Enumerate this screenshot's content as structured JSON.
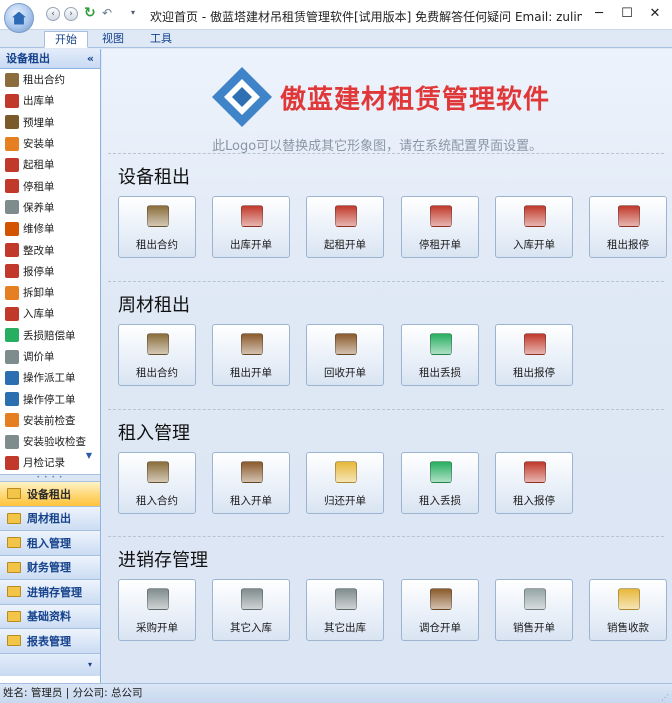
{
  "titlebar": {
    "title": "欢迎首页 - 傲蓝塔建材吊租赁管理软件[试用版本] 免费解答任何疑问 Email: zulin...",
    "minimize": "─",
    "maximize": "☐",
    "close": "✕"
  },
  "tabs": [
    "开始",
    "视图",
    "工具"
  ],
  "sidebar": {
    "header": "设备租出",
    "collapse": "«",
    "items": [
      {
        "label": "租出合约",
        "icon": "contract-icon",
        "color": "#8a6d3b"
      },
      {
        "label": "出库单",
        "icon": "truck-out-icon",
        "color": "#c0392b"
      },
      {
        "label": "预埋单",
        "icon": "shovel-icon",
        "color": "#7a5a2a"
      },
      {
        "label": "安装单",
        "icon": "install-icon",
        "color": "#e67e22"
      },
      {
        "label": "起租单",
        "icon": "calendar-start-icon",
        "color": "#c0392b"
      },
      {
        "label": "停租单",
        "icon": "calendar-stop-icon",
        "color": "#c0392b"
      },
      {
        "label": "保养单",
        "icon": "maintenance-icon",
        "color": "#7f8c8d"
      },
      {
        "label": "维修单",
        "icon": "repair-icon",
        "color": "#d35400"
      },
      {
        "label": "整改单",
        "icon": "rectify-icon",
        "color": "#c0392b"
      },
      {
        "label": "报停单",
        "icon": "report-stop-icon",
        "color": "#c0392b"
      },
      {
        "label": "拆卸单",
        "icon": "dismantle-icon",
        "color": "#e67e22"
      },
      {
        "label": "入库单",
        "icon": "truck-in-icon",
        "color": "#c0392b"
      },
      {
        "label": "丢损赔偿单",
        "icon": "loss-icon",
        "color": "#27ae60"
      },
      {
        "label": "调价单",
        "icon": "price-icon",
        "color": "#7f8c8d"
      },
      {
        "label": "操作派工单",
        "icon": "dispatch-icon",
        "color": "#2c6fb0"
      },
      {
        "label": "操作停工单",
        "icon": "stop-work-icon",
        "color": "#2c6fb0"
      },
      {
        "label": "安装前检查",
        "icon": "pre-check-icon",
        "color": "#e67e22"
      },
      {
        "label": "安装验收检查",
        "icon": "acceptance-icon",
        "color": "#7f8c8d"
      },
      {
        "label": "月检记录",
        "icon": "monthly-check-icon",
        "color": "#c0392b"
      }
    ],
    "groups": [
      {
        "label": "设备租出",
        "active": true
      },
      {
        "label": "周材租出",
        "active": false
      },
      {
        "label": "租入管理",
        "active": false
      },
      {
        "label": "财务管理",
        "active": false
      },
      {
        "label": "进销存管理",
        "active": false
      },
      {
        "label": "基础资料",
        "active": false
      },
      {
        "label": "报表管理",
        "active": false
      }
    ]
  },
  "logo": {
    "title": "傲蓝建材租赁管理软件",
    "subtitle": "此Logo可以替换成其它形象图，请在系统配置界面设置。",
    "color": "#e03838"
  },
  "sections": [
    {
      "title": "设备租出",
      "tiles": [
        {
          "label": "租出合约",
          "icon": "contract-icon",
          "color": "#8a6d3b"
        },
        {
          "label": "出库开单",
          "icon": "truck-out-icon",
          "color": "#c0392b"
        },
        {
          "label": "起租开单",
          "icon": "calendar-start-icon",
          "color": "#c0392b"
        },
        {
          "label": "停租开单",
          "icon": "calendar-stop-icon",
          "color": "#c0392b"
        },
        {
          "label": "入库开单",
          "icon": "truck-in-icon",
          "color": "#c0392b"
        },
        {
          "label": "租出报停",
          "icon": "report-stop-icon",
          "color": "#c0392b"
        }
      ]
    },
    {
      "title": "周材租出",
      "tiles": [
        {
          "label": "租出合约",
          "icon": "contract-icon",
          "color": "#8a6d3b"
        },
        {
          "label": "租出开单",
          "icon": "house-out-icon",
          "color": "#8a5a2b"
        },
        {
          "label": "回收开单",
          "icon": "house-return-icon",
          "color": "#8a5a2b"
        },
        {
          "label": "租出丢损",
          "icon": "loss-icon",
          "color": "#27ae60"
        },
        {
          "label": "租出报停",
          "icon": "report-stop-icon",
          "color": "#c0392b"
        }
      ]
    },
    {
      "title": "租入管理",
      "tiles": [
        {
          "label": "租入合约",
          "icon": "contract-icon",
          "color": "#8a6d3b"
        },
        {
          "label": "租入开单",
          "icon": "house-in-icon",
          "color": "#8a5a2b"
        },
        {
          "label": "归还开单",
          "icon": "return-icon",
          "color": "#e6b83a"
        },
        {
          "label": "租入丢损",
          "icon": "loss-icon",
          "color": "#27ae60"
        },
        {
          "label": "租入报停",
          "icon": "report-stop-icon",
          "color": "#c0392b"
        }
      ]
    },
    {
      "title": "进销存管理",
      "tiles": [
        {
          "label": "采购开单",
          "icon": "cart-icon",
          "color": "#7f8c8d"
        },
        {
          "label": "其它入库",
          "icon": "box-in-icon",
          "color": "#7f8c8d"
        },
        {
          "label": "其它出库",
          "icon": "box-out-icon",
          "color": "#7f8c8d"
        },
        {
          "label": "调仓开单",
          "icon": "warehouse-icon",
          "color": "#8a5a2b"
        },
        {
          "label": "销售开单",
          "icon": "sales-doc-icon",
          "color": "#95a5a6"
        },
        {
          "label": "销售收款",
          "icon": "payment-icon",
          "color": "#e6b83a"
        }
      ]
    }
  ],
  "statusbar": {
    "text": "姓名: 管理员  |  分公司: 总公司"
  }
}
